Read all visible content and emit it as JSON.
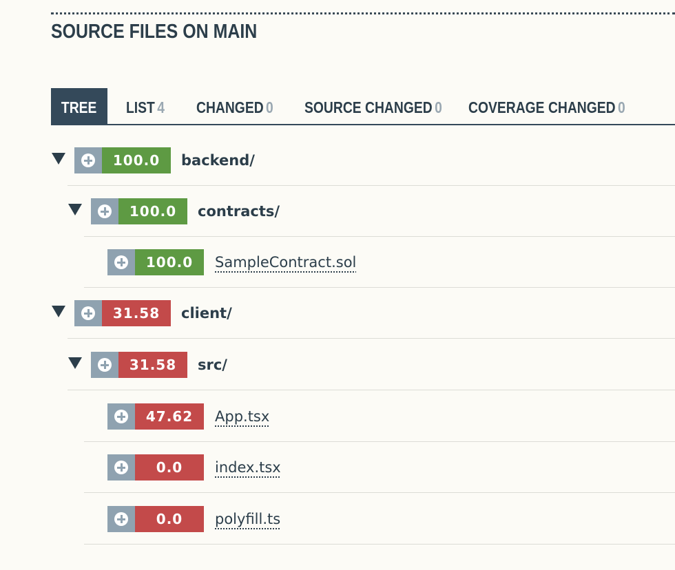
{
  "header": {
    "title": "SOURCE FILES ON MAIN"
  },
  "tabs": [
    {
      "label": "TREE",
      "count": "",
      "active": true
    },
    {
      "label": "LIST",
      "count": "4"
    },
    {
      "label": "CHANGED",
      "count": "0"
    },
    {
      "label": "SOURCE CHANGED",
      "count": "0"
    },
    {
      "label": "COVERAGE CHANGED",
      "count": "0"
    }
  ],
  "tree": [
    {
      "name": "backend/",
      "type": "directory",
      "coverage": "100.0",
      "status": "good",
      "depth": 0,
      "expanded": true
    },
    {
      "name": "contracts/",
      "type": "directory",
      "coverage": "100.0",
      "status": "good",
      "depth": 1,
      "expanded": true
    },
    {
      "name": "SampleContract.sol",
      "type": "file",
      "coverage": "100.0",
      "status": "good",
      "depth": 2
    },
    {
      "name": "client/",
      "type": "directory",
      "coverage": "31.58",
      "status": "bad",
      "depth": 0,
      "expanded": true
    },
    {
      "name": "src/",
      "type": "directory",
      "coverage": "31.58",
      "status": "bad",
      "depth": 1,
      "expanded": true
    },
    {
      "name": "App.tsx",
      "type": "file",
      "coverage": "47.62",
      "status": "bad",
      "depth": 2
    },
    {
      "name": "index.tsx",
      "type": "file",
      "coverage": "0.0",
      "status": "bad",
      "depth": 2
    },
    {
      "name": "polyfill.ts",
      "type": "file",
      "coverage": "0.0",
      "status": "bad",
      "depth": 2
    }
  ],
  "colors": {
    "good": "#5e9a43",
    "bad": "#c34a4a",
    "expand_button": "#8fa2b0",
    "tab_active": "#34495a"
  },
  "icons": {
    "toggle": "triangle-down-icon",
    "expand": "plus-circle-icon"
  }
}
